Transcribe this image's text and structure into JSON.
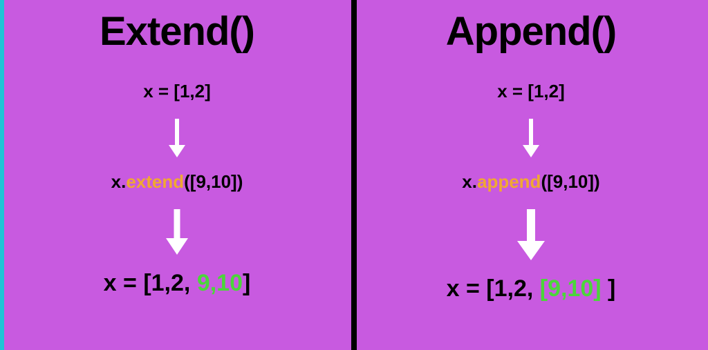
{
  "left": {
    "title": "Extend()",
    "initial": "x = [1,2]",
    "call_obj": "x.",
    "call_method": "extend",
    "call_args": "([9,10])",
    "result_prefix": "x = [1,2, ",
    "result_added": "9,10",
    "result_suffix": "]"
  },
  "right": {
    "title": "Append()",
    "initial": "x = [1,2]",
    "call_obj": "x.",
    "call_method": "append",
    "call_args": "([9,10])",
    "result_prefix": "x = [1,2, ",
    "result_added": "[9,10]",
    "result_suffix": " ]"
  }
}
